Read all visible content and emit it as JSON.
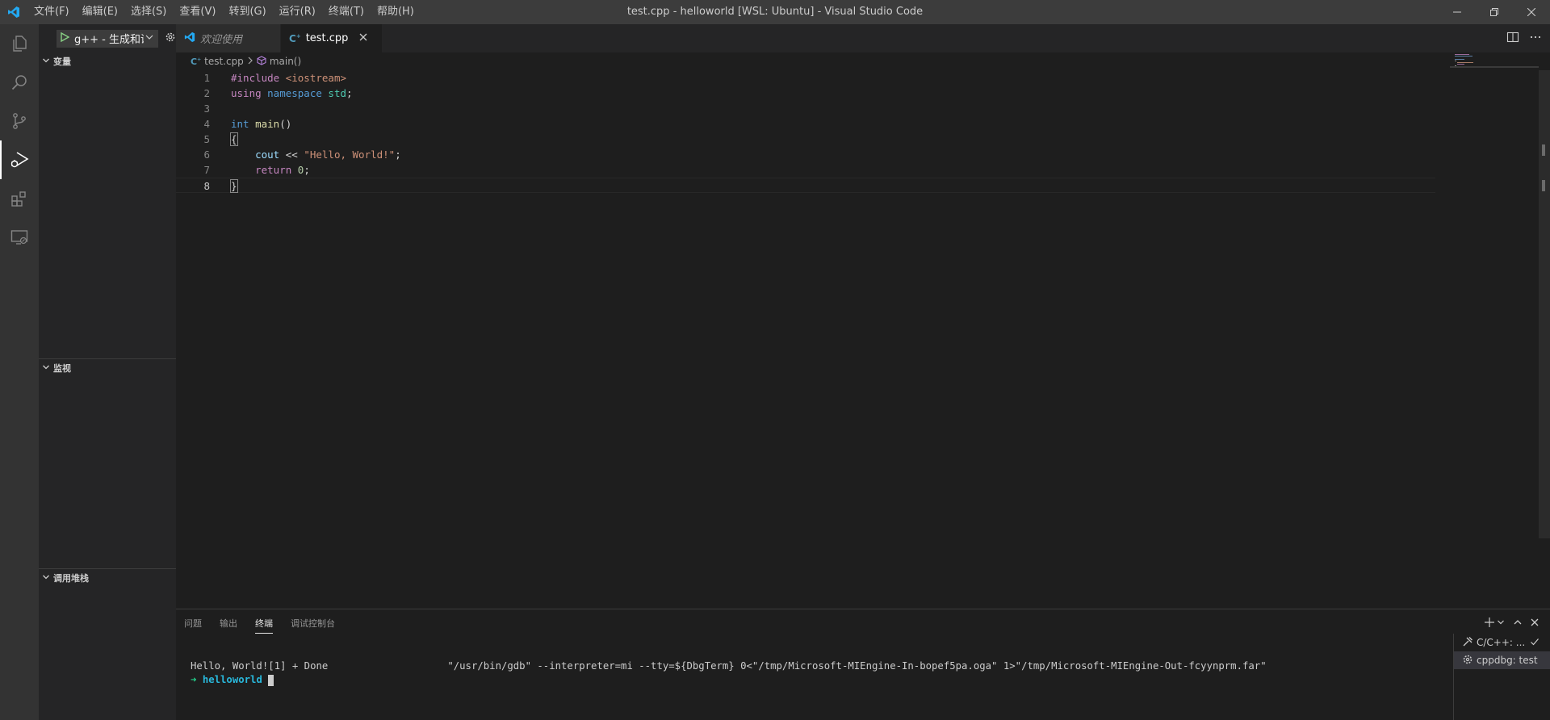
{
  "window": {
    "title": "test.cpp - helloworld [WSL: Ubuntu] - Visual Studio Code",
    "accent": "#007acc"
  },
  "menu": [
    "文件(F)",
    "编辑(E)",
    "选择(S)",
    "查看(V)",
    "转到(G)",
    "运行(R)",
    "终端(T)",
    "帮助(H)"
  ],
  "activity_bar": {
    "items": [
      "explorer-icon",
      "search-icon",
      "source-control-icon",
      "run-debug-icon",
      "extensions-icon",
      "remote-explorer-icon"
    ],
    "active": "run-debug-icon"
  },
  "sidebar": {
    "launch_config": "g++ - 生成和调试活动文件",
    "sections": {
      "variables": "变量",
      "watch": "监视",
      "call_stack": "调用堆栈"
    }
  },
  "tabs": [
    {
      "label": "欢迎使用",
      "active": false,
      "icon": "vscode-logo-icon"
    },
    {
      "label": "test.cpp",
      "active": true,
      "icon": "cpp-file-icon"
    }
  ],
  "breadcrumbs": {
    "file": "test.cpp",
    "symbol": "main()"
  },
  "code": {
    "line_numbers": [
      "1",
      "2",
      "3",
      "4",
      "5",
      "6",
      "7",
      "8"
    ],
    "current_line": "8",
    "lines": [
      [
        {
          "t": "#include ",
          "c": "kw"
        },
        {
          "t": "<iostream>",
          "c": "str"
        }
      ],
      [
        {
          "t": "using ",
          "c": "kw"
        },
        {
          "t": "namespace ",
          "c": "type"
        },
        {
          "t": "std",
          "c": "ns"
        },
        {
          "t": ";",
          "c": "plain"
        }
      ],
      [],
      [
        {
          "t": "int ",
          "c": "type"
        },
        {
          "t": "main",
          "c": "fn"
        },
        {
          "t": "()",
          "c": "plain"
        }
      ],
      [
        {
          "t": "{",
          "c": "plain"
        }
      ],
      [
        {
          "t": "    ",
          "c": "plain"
        },
        {
          "t": "cout",
          "c": "var"
        },
        {
          "t": " << ",
          "c": "plain"
        },
        {
          "t": "\"Hello, World!\"",
          "c": "str"
        },
        {
          "t": ";",
          "c": "plain"
        }
      ],
      [
        {
          "t": "    ",
          "c": "plain"
        },
        {
          "t": "return ",
          "c": "kw"
        },
        {
          "t": "0",
          "c": "num"
        },
        {
          "t": ";",
          "c": "plain"
        }
      ],
      [
        {
          "t": "}",
          "c": "plain"
        }
      ]
    ]
  },
  "panel": {
    "tabs": [
      "问题",
      "输出",
      "终端",
      "调试控制台"
    ],
    "active_tab": "终端",
    "terminal_lines": {
      "line1": "Hello, World![1] + Done                    \"/usr/bin/gdb\" --interpreter=mi --tty=${DbgTerm} 0<\"/tmp/Microsoft-MIEngine-In-bopef5pa.oga\" 1>\"/tmp/Microsoft-MIEngine-Out-fcyynprm.far\"",
      "prompt_arrow": "➜",
      "prompt_dir": "helloworld"
    },
    "terminals": [
      {
        "label": "C/C++: ...",
        "icon": "tools-icon",
        "done": true
      },
      {
        "label": "cppdbg: test",
        "icon": "debug-gear-icon",
        "done": false
      }
    ]
  }
}
